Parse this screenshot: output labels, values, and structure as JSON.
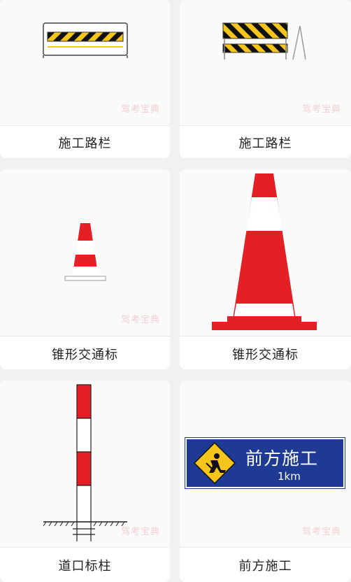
{
  "watermark": "驾考宝典",
  "cards": [
    {
      "label": "施工路栏",
      "icon": "barrier-fence-icon"
    },
    {
      "label": "施工路栏",
      "icon": "barrier-stand-icon"
    },
    {
      "label": "锥形交通标",
      "icon": "small-traffic-cone-icon"
    },
    {
      "label": "锥形交通标",
      "icon": "large-traffic-cone-icon"
    },
    {
      "label": "道口标柱",
      "icon": "crossing-post-icon"
    },
    {
      "label": "前方施工",
      "icon": "construction-ahead-sign-icon"
    }
  ],
  "sign": {
    "title": "前方施工",
    "distance": "1km"
  },
  "colors": {
    "red": "#e41f26",
    "yellow": "#f5c51b",
    "blue": "#1e3a94",
    "background": "#f1f1f1"
  }
}
